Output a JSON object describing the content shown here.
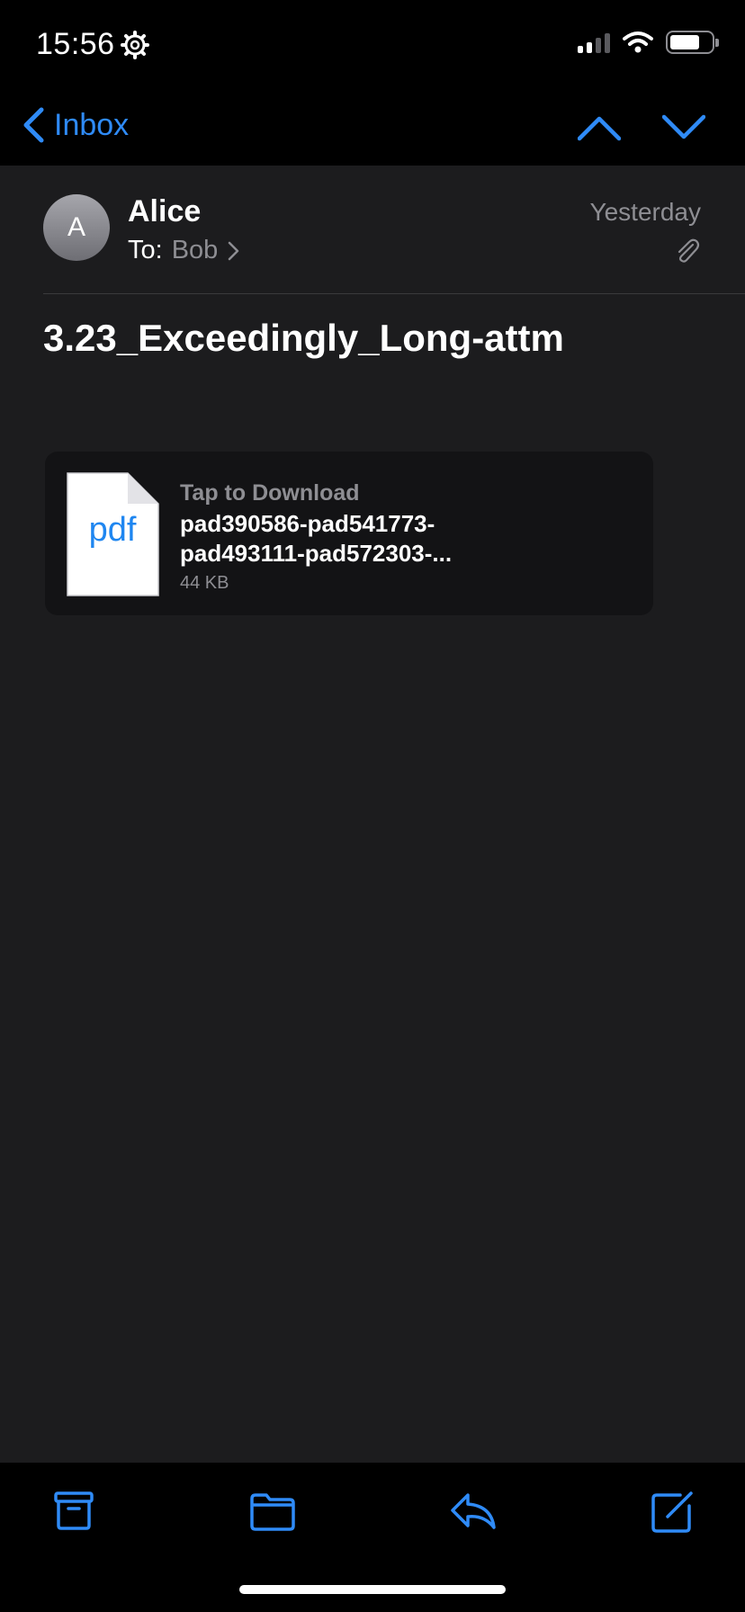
{
  "status_bar": {
    "time": "15:56",
    "icons": [
      "gear-icon",
      "cellular-signal-icon",
      "wifi-icon",
      "battery-icon"
    ]
  },
  "nav": {
    "back_label": "Inbox",
    "icons": [
      "chevron-left-icon",
      "chevron-up-icon",
      "chevron-down-icon"
    ]
  },
  "message": {
    "avatar_initial": "A",
    "sender": "Alice",
    "to_label": "To:",
    "to_name": "Bob",
    "date": "Yesterday",
    "subject": "3.23_Exceedingly_Long-attm"
  },
  "attachment": {
    "file_type_label": "pdf",
    "action": "Tap to Download",
    "name_line1": "pad390586-pad541773-",
    "name_line2": "pad493111-pad572303-...",
    "size": "44 KB"
  },
  "toolbar": {
    "icons": [
      "archive-icon",
      "folder-icon",
      "reply-icon",
      "compose-icon"
    ]
  },
  "colors": {
    "accent": "#2f8bf7",
    "background": "#1c1c1e",
    "bar_background": "#000000",
    "secondary_text": "#8e8e93",
    "card_background": "#131315"
  }
}
